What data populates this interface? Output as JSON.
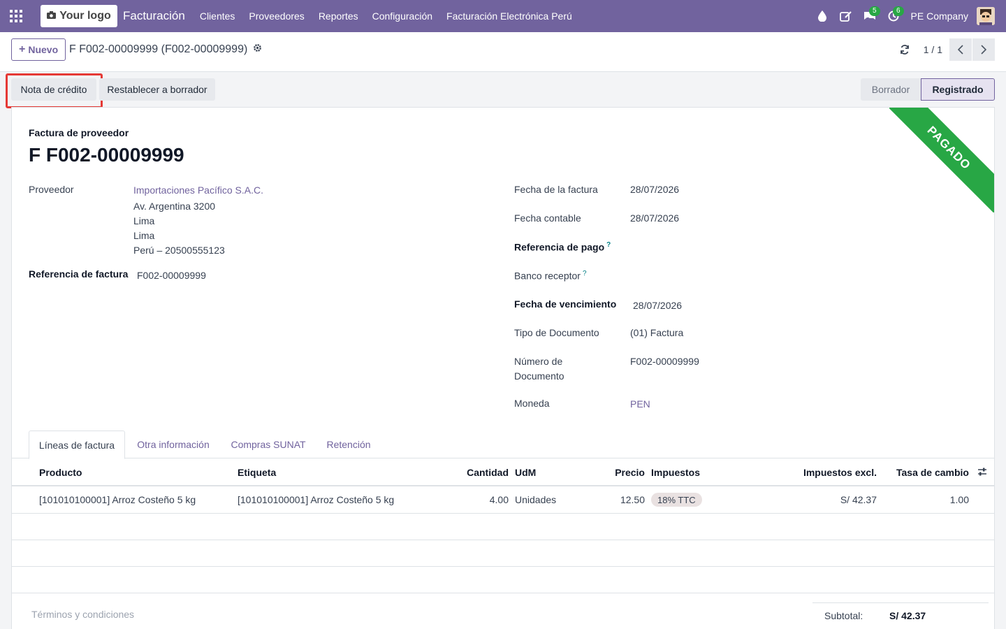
{
  "navbar": {
    "logo": "Your logo",
    "brand": "Facturación",
    "menu": [
      "Clientes",
      "Proveedores",
      "Reportes",
      "Configuración",
      "Facturación Electrónica Perú"
    ],
    "messages_badge": "5",
    "activities_badge": "6",
    "company": "PE Company",
    "bg_color": "#71639e"
  },
  "control_panel": {
    "new_label": "Nuevo",
    "breadcrumb": "F F002-00009999 (F002-00009999)",
    "pager": "1 / 1"
  },
  "status_bar": {
    "credit_note_label": "Nota de crédito",
    "reset_label": "Restablecer a borrador",
    "states": [
      "Borrador",
      "Registrado"
    ],
    "current_state": "Registrado"
  },
  "ribbon": "PAGADO",
  "form": {
    "doc_type": "Factura de proveedor",
    "name": "F F002-00009999",
    "vendor_label": "Proveedor",
    "vendor_name": "Importaciones Pacífico S.A.C.",
    "vendor_address": [
      "Av. Argentina 3200",
      "Lima",
      "Lima",
      "Perú – 20500555123"
    ],
    "bill_ref_label": "Referencia de factura",
    "bill_ref": "F002-00009999",
    "invoice_date_label": "Fecha de la factura",
    "invoice_date": "28/07/2026",
    "accounting_date_label": "Fecha contable",
    "accounting_date": "28/07/2026",
    "payment_ref_label": "Referencia de pago",
    "bank_label": "Banco receptor",
    "due_date_label": "Fecha de vencimiento",
    "due_date": "28/07/2026",
    "doc_type_label": "Tipo de Documento",
    "doc_type_value": "(01) Factura",
    "doc_number_label_1": "Número de",
    "doc_number_label_2": "Documento",
    "doc_number": "F002-00009999",
    "currency_label": "Moneda",
    "currency": "PEN"
  },
  "tabs": [
    "Líneas de factura",
    "Otra información",
    "Compras SUNAT",
    "Retención"
  ],
  "table": {
    "headers": [
      "Producto",
      "Etiqueta",
      "Cantidad",
      "UdM",
      "Precio",
      "Impuestos",
      "Impuestos excl.",
      "Tasa de cambio"
    ],
    "rows": [
      {
        "product": "[101010100001] Arroz Costeño 5 kg",
        "label": "[101010100001] Arroz Costeño 5 kg",
        "quantity": "4.00",
        "uom": "Unidades",
        "price": "12.50",
        "tax": "18% TTC",
        "subtotal": "S/ 42.37",
        "rate": "1.00"
      }
    ]
  },
  "footer": {
    "terms_placeholder": "Términos y condiciones",
    "subtotal_label": "Subtotal:",
    "subtotal_value": "S/ 42.37"
  }
}
